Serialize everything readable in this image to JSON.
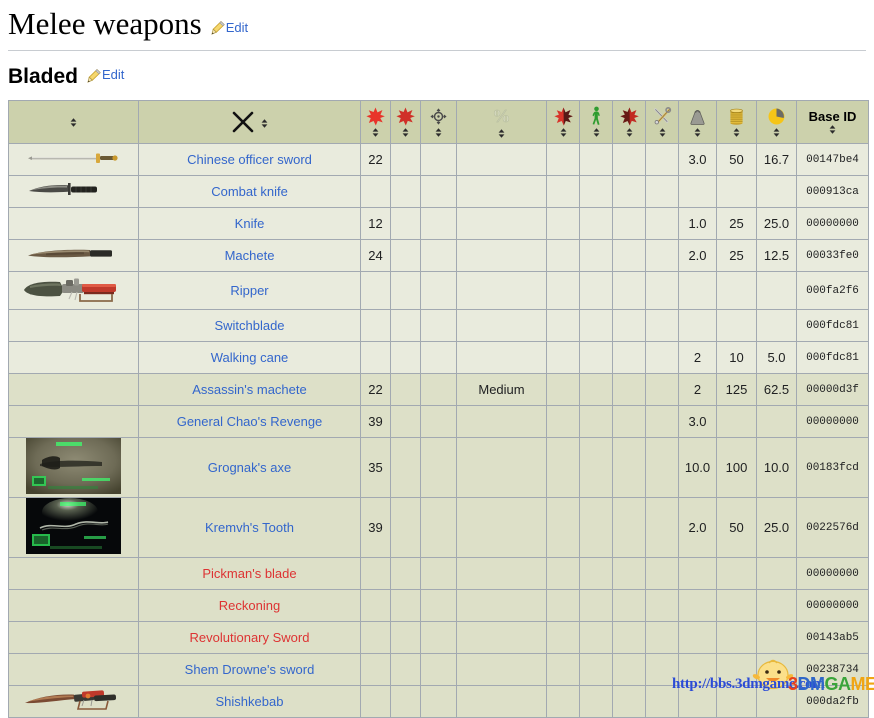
{
  "page": {
    "title": "Melee weapons",
    "edit_label": "Edit"
  },
  "section": {
    "title": "Bladed",
    "edit_label": "Edit"
  },
  "table": {
    "columns": [
      {
        "key": "image",
        "icon": "none",
        "label": "",
        "sortable": true
      },
      {
        "key": "name",
        "icon": "crossed-swords-icon",
        "label": "",
        "sortable": true
      },
      {
        "key": "dam",
        "icon": "red-star-damage-icon",
        "label": "",
        "sortable": true
      },
      {
        "key": "dam2",
        "icon": "red-star-damage-icon",
        "label": "",
        "sortable": true
      },
      {
        "key": "acc",
        "icon": "crosshair-icon",
        "label": "",
        "sortable": true
      },
      {
        "key": "spread",
        "icon": "percent-icon",
        "label": "",
        "sortable": true
      },
      {
        "key": "bleed",
        "icon": "red-black-star-icon",
        "label": "",
        "sortable": true
      },
      {
        "key": "limb",
        "icon": "green-walker-icon",
        "label": "",
        "sortable": true
      },
      {
        "key": "crit",
        "icon": "dark-red-star-icon",
        "label": "",
        "sortable": true
      },
      {
        "key": "ap",
        "icon": "tools-icon",
        "label": "",
        "sortable": true
      },
      {
        "key": "weight",
        "icon": "weight-icon",
        "label": "",
        "sortable": true
      },
      {
        "key": "caps",
        "icon": "caps-stack-icon",
        "label": "",
        "sortable": true
      },
      {
        "key": "ratio",
        "icon": "pie-chart-icon",
        "label": "",
        "sortable": true
      },
      {
        "key": "baseid",
        "icon": "none",
        "label": "Base ID",
        "sortable": true
      }
    ],
    "rows": [
      {
        "group": "common",
        "thumb": "sword-sprite",
        "tall": false,
        "name": "Chinese officer sword",
        "link_state": "blue",
        "dam": "22",
        "dam2": "",
        "acc": "",
        "spread": "",
        "bleed": "",
        "limb": "",
        "crit": "",
        "ap": "",
        "weight": "3.0",
        "caps": "50",
        "ratio": "16.7",
        "baseid": "00147be4"
      },
      {
        "group": "common",
        "thumb": "combat-knife-sprite",
        "tall": false,
        "name": "Combat knife",
        "link_state": "blue",
        "dam": "",
        "dam2": "",
        "acc": "",
        "spread": "",
        "bleed": "",
        "limb": "",
        "crit": "",
        "ap": "",
        "weight": "",
        "caps": "",
        "ratio": "",
        "baseid": "000913ca"
      },
      {
        "group": "common",
        "thumb": "none",
        "tall": false,
        "name": "Knife",
        "link_state": "blue",
        "dam": "12",
        "dam2": "",
        "acc": "",
        "spread": "",
        "bleed": "",
        "limb": "",
        "crit": "",
        "ap": "",
        "weight": "1.0",
        "caps": "25",
        "ratio": "25.0",
        "baseid": "00000000"
      },
      {
        "group": "common",
        "thumb": "machete-sprite",
        "tall": false,
        "name": "Machete",
        "link_state": "blue",
        "dam": "24",
        "dam2": "",
        "acc": "",
        "spread": "",
        "bleed": "",
        "limb": "",
        "crit": "",
        "ap": "",
        "weight": "2.0",
        "caps": "25",
        "ratio": "12.5",
        "baseid": "00033fe0"
      },
      {
        "group": "common",
        "thumb": "ripper-sprite",
        "tall": false,
        "name": "Ripper",
        "link_state": "blue",
        "dam": "",
        "dam2": "",
        "acc": "",
        "spread": "",
        "bleed": "",
        "limb": "",
        "crit": "",
        "ap": "",
        "weight": "",
        "caps": "",
        "ratio": "",
        "baseid": "000fa2f6"
      },
      {
        "group": "common",
        "thumb": "none",
        "tall": false,
        "name": "Switchblade",
        "link_state": "blue",
        "dam": "",
        "dam2": "",
        "acc": "",
        "spread": "",
        "bleed": "",
        "limb": "",
        "crit": "",
        "ap": "",
        "weight": "",
        "caps": "",
        "ratio": "",
        "baseid": "000fdc81"
      },
      {
        "group": "common",
        "thumb": "none",
        "tall": false,
        "name": "Walking cane",
        "link_state": "blue",
        "dam": "",
        "dam2": "",
        "acc": "",
        "spread": "",
        "bleed": "",
        "limb": "",
        "crit": "",
        "ap": "",
        "weight": "2",
        "caps": "10",
        "ratio": "5.0",
        "baseid": "000fdc81"
      },
      {
        "group": "unique",
        "thumb": "none",
        "tall": false,
        "name": "Assassin's machete",
        "link_state": "blue",
        "dam": "22",
        "dam2": "",
        "acc": "",
        "spread": "Medium",
        "bleed": "",
        "limb": "",
        "crit": "",
        "ap": "",
        "weight": "2",
        "caps": "125",
        "ratio": "62.5",
        "baseid": "00000d3f"
      },
      {
        "group": "unique",
        "thumb": "none",
        "tall": false,
        "name": "General Chao's Revenge",
        "link_state": "blue",
        "dam": "39",
        "dam2": "",
        "acc": "",
        "spread": "",
        "bleed": "",
        "limb": "",
        "crit": "",
        "ap": "",
        "weight": "3.0",
        "caps": "",
        "ratio": "",
        "baseid": "00000000"
      },
      {
        "group": "unique",
        "thumb": "grognak-axe-screenshot",
        "tall": true,
        "name": "Grognak's axe",
        "link_state": "blue",
        "dam": "35",
        "dam2": "",
        "acc": "",
        "spread": "",
        "bleed": "",
        "limb": "",
        "crit": "",
        "ap": "",
        "weight": "10.0",
        "caps": "100",
        "ratio": "10.0",
        "baseid": "00183fcd"
      },
      {
        "group": "unique",
        "thumb": "kremvh-tooth-screenshot",
        "tall": true,
        "name": "Kremvh's Tooth",
        "link_state": "blue",
        "dam": "39",
        "dam2": "",
        "acc": "",
        "spread": "",
        "bleed": "",
        "limb": "",
        "crit": "",
        "ap": "",
        "weight": "2.0",
        "caps": "50",
        "ratio": "25.0",
        "baseid": "0022576d"
      },
      {
        "group": "unique",
        "thumb": "none",
        "tall": false,
        "name": "Pickman's blade",
        "link_state": "red",
        "dam": "",
        "dam2": "",
        "acc": "",
        "spread": "",
        "bleed": "",
        "limb": "",
        "crit": "",
        "ap": "",
        "weight": "",
        "caps": "",
        "ratio": "",
        "baseid": "00000000"
      },
      {
        "group": "unique",
        "thumb": "none",
        "tall": false,
        "name": "Reckoning",
        "link_state": "red",
        "dam": "",
        "dam2": "",
        "acc": "",
        "spread": "",
        "bleed": "",
        "limb": "",
        "crit": "",
        "ap": "",
        "weight": "",
        "caps": "",
        "ratio": "",
        "baseid": "00000000"
      },
      {
        "group": "unique",
        "thumb": "none",
        "tall": false,
        "name": "Revolutionary Sword",
        "link_state": "red",
        "dam": "",
        "dam2": "",
        "acc": "",
        "spread": "",
        "bleed": "",
        "limb": "",
        "crit": "",
        "ap": "",
        "weight": "",
        "caps": "",
        "ratio": "",
        "baseid": "00143ab5"
      },
      {
        "group": "unique",
        "thumb": "none",
        "tall": false,
        "name": "Shem Drowne's sword",
        "link_state": "blue",
        "dam": "",
        "dam2": "",
        "acc": "",
        "spread": "",
        "bleed": "",
        "limb": "",
        "crit": "",
        "ap": "",
        "weight": "",
        "caps": "",
        "ratio": "",
        "baseid": "00238734"
      },
      {
        "group": "unique",
        "thumb": "shishkebab-sprite",
        "tall": false,
        "name": "Shishkebab",
        "link_state": "blue",
        "dam": "",
        "dam2": "",
        "acc": "",
        "spread": "",
        "bleed": "",
        "limb": "",
        "crit": "",
        "ap": "",
        "weight": "",
        "caps": "",
        "ratio": "",
        "baseid": "000da2fb"
      }
    ]
  },
  "watermark": {
    "url": "http://bbs.3dmgame.com",
    "brand_parts": [
      "3",
      "DM",
      "GA",
      "ME"
    ],
    "chick_icon": "chick-mascot-icon"
  },
  "colors": {
    "header_bg": "#ccd1ac",
    "row_common_bg": "#e9ebdd",
    "row_unique_bg": "#dde0c8",
    "border": "#a2a9b1",
    "link_blue": "#3366cc",
    "link_red": "#dd3333"
  }
}
